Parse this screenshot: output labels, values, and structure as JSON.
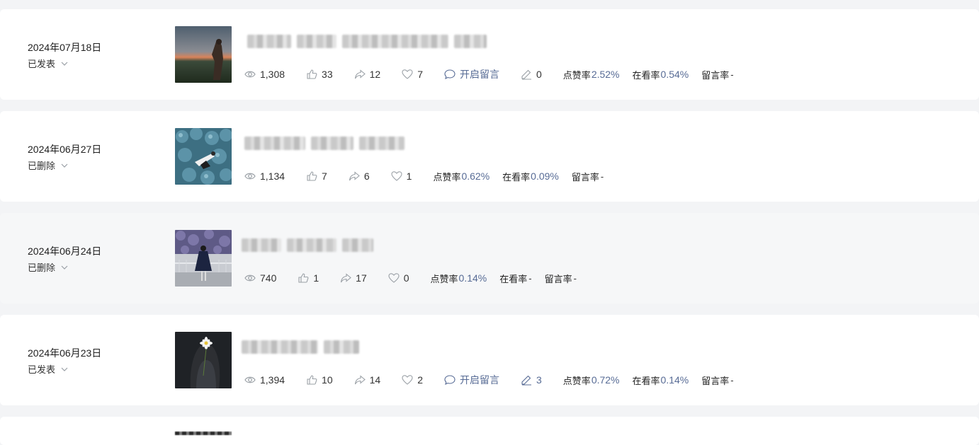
{
  "articles": [
    {
      "date": "2024年07月18日",
      "status": "已发表",
      "views": "1,308",
      "likes": "33",
      "shares": "12",
      "favorites": "7",
      "comment_toggle": "开启留言",
      "comments": "0",
      "like_rate_label": "点赞率",
      "like_rate": "2.52%",
      "watch_rate_label": "在看率",
      "watch_rate": "0.54%",
      "comment_rate_label": "留言率",
      "comment_rate": "-"
    },
    {
      "date": "2024年06月27日",
      "status": "已删除",
      "views": "1,134",
      "likes": "7",
      "shares": "6",
      "favorites": "1",
      "like_rate_label": "点赞率",
      "like_rate": "0.62%",
      "watch_rate_label": "在看率",
      "watch_rate": "0.09%",
      "comment_rate_label": "留言率",
      "comment_rate": "-"
    },
    {
      "date": "2024年06月24日",
      "status": "已删除",
      "views": "740",
      "likes": "1",
      "shares": "17",
      "favorites": "0",
      "like_rate_label": "点赞率",
      "like_rate": "0.14%",
      "watch_rate_label": "在看率",
      "watch_rate": "-",
      "comment_rate_label": "留言率",
      "comment_rate": "-"
    },
    {
      "date": "2024年06月23日",
      "status": "已发表",
      "views": "1,394",
      "likes": "10",
      "shares": "14",
      "favorites": "2",
      "comment_toggle": "开启留言",
      "comments": "3",
      "like_rate_label": "点赞率",
      "like_rate": "0.72%",
      "watch_rate_label": "在看率",
      "watch_rate": "0.14%",
      "comment_rate_label": "留言率",
      "comment_rate": "-"
    }
  ],
  "icons": {
    "views": "eye-icon",
    "likes": "thumbs-up-icon",
    "shares": "share-icon",
    "favorites": "heart-icon",
    "comment_toggle": "comment-bubble-icon",
    "comments": "pen-icon",
    "status": "chevron-down-icon"
  },
  "colors": {
    "accent": "#576b95",
    "background": "#f3f4f6",
    "card": "#ffffff",
    "icon": "#9aa0a6"
  }
}
